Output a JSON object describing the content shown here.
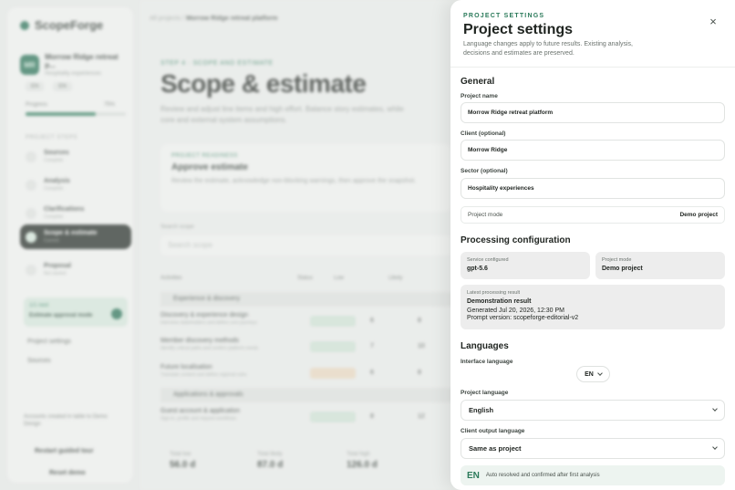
{
  "app": {
    "name": "ScopeForge"
  },
  "sidebar": {
    "project_name": "Morrow Ridge retreat p...",
    "project_sub": "Hospitality experiences",
    "avatar": "MR",
    "chips": [
      "EN",
      "EN"
    ],
    "progress_label": "Progress",
    "progress_value": "75%",
    "progress": 0.7,
    "section": "PROJECT STEPS",
    "steps": [
      {
        "title": "Sources",
        "status": "Complete"
      },
      {
        "title": "Analysis",
        "status": "Complete"
      },
      {
        "title": "Clarifications",
        "status": "Complete"
      },
      {
        "title": "Scope & estimate",
        "status": "Current"
      },
      {
        "title": "Proposal",
        "status": "Not started"
      }
    ],
    "cta_small": "1/1 next",
    "cta_title": "Estimate approval mode",
    "links": [
      "Project settings",
      "Sources"
    ],
    "note": "Accounts created in table to Demo Design",
    "buttons": [
      "Restart guided tour",
      "Reset demo"
    ]
  },
  "main": {
    "breadcrumb_parent": "All projects",
    "breadcrumb_current": "Morrow Ridge retreat platform",
    "eyebrow": "STEP 4 · SCOPE AND ESTIMATE",
    "title": "Scope & estimate",
    "lead": "Review and adjust line items and high effort. Balance story estimates, while core and external system assumptions.",
    "panel_eyebrow": "PROJECT READINESS",
    "panel_title": "Approve estimate",
    "panel_text": "Review the estimate, acknowledge non-blocking warnings, then approve the snapshot.",
    "search_label": "Search scope",
    "search_placeholder": "Search scope",
    "columns": [
      "Activities",
      "Status",
      "Low",
      "Likely"
    ],
    "groups": [
      "Experience & discovery",
      "Applications & approvals"
    ],
    "rows": [
      {
        "title": "Discovery & experience design",
        "sub": "Interview stakeholders and define core journeys",
        "low": "6",
        "likely": "8"
      },
      {
        "title": "Member discovery methods",
        "sub": "Identify critical paths and confirm platform needs",
        "low": "7",
        "likely": "10"
      },
      {
        "title": "Future localisation",
        "sub": "Translate content and define regional rules",
        "low": "6",
        "likely": "8"
      },
      {
        "title": "Guest account & application",
        "sub": "Sign-in, profile and request workflows",
        "low": "8",
        "likely": "12"
      }
    ],
    "summary": [
      {
        "label": "Total low",
        "value": "56.0 d"
      },
      {
        "label": "Total likely",
        "value": "87.0 d"
      },
      {
        "label": "Total high",
        "value": "126.0 d"
      }
    ]
  },
  "drawer": {
    "eyebrow": "PROJECT SETTINGS",
    "title": "Project settings",
    "subtitle": "Language changes apply to future results. Existing analysis, decisions and estimates are preserved.",
    "close_icon": "×",
    "general": {
      "heading": "General",
      "project_name_label": "Project name",
      "project_name": "Morrow Ridge retreat platform",
      "client_label": "Client (optional)",
      "client": "Morrow Ridge",
      "sector_label": "Sector (optional)",
      "sector": "Hospitality experiences",
      "mode_label": "Project mode",
      "mode_value": "Demo project"
    },
    "processing": {
      "heading": "Processing configuration",
      "service_label": "Service configured",
      "service_value": "gpt-5.6",
      "mode_label": "Project mode",
      "mode_value": "Demo project",
      "latest_label": "Latest processing result",
      "latest_title": "Demonstration result",
      "generated": "Generated Jul 20, 2026, 12:30 PM",
      "prompt": "Prompt version: scopeforge-editorial-v2"
    },
    "languages": {
      "heading": "Languages",
      "interface_label": "Interface language",
      "interface_value": "EN",
      "project_label": "Project language",
      "project_value": "English",
      "client_output_label": "Client output language",
      "client_output_value": "Same as project",
      "auto_code": "EN",
      "auto_text": "Auto resolved and confirmed after first analysis"
    }
  }
}
